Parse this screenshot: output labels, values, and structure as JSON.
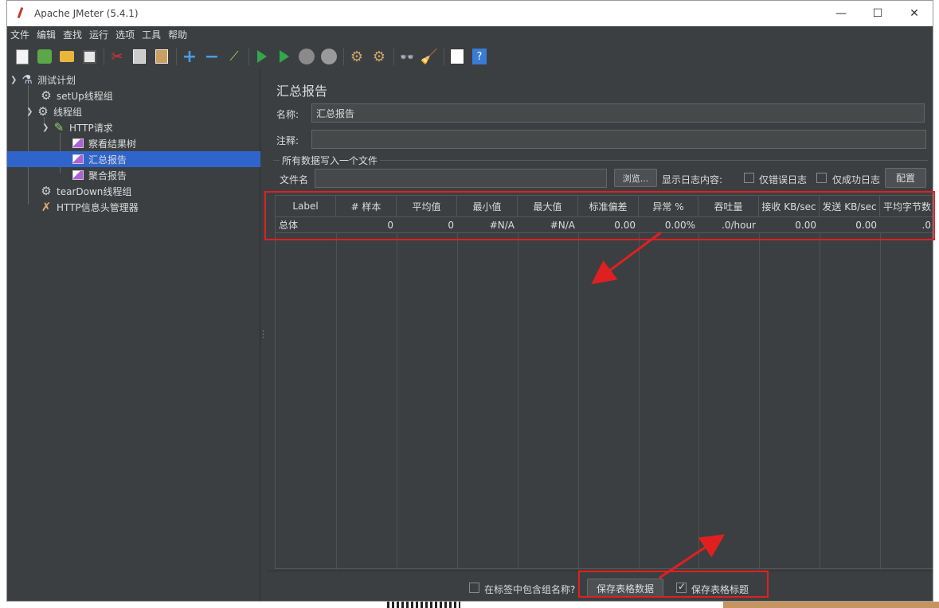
{
  "window": {
    "title": "Apache JMeter (5.4.1)",
    "controls": {
      "minimize": "—",
      "maximize": "☐",
      "close": "✕"
    }
  },
  "menu": [
    "文件",
    "编辑",
    "查找",
    "运行",
    "选项",
    "工具",
    "帮助"
  ],
  "toolbar_icons": [
    "new-icon",
    "templates-icon",
    "open-icon",
    "save-icon",
    "cut-icon",
    "copy-icon",
    "paste-icon",
    "expand-icon",
    "collapse-icon",
    "toggle-icon",
    "start-icon",
    "start-no-pause-icon",
    "stop-icon",
    "shutdown-icon",
    "clear-icon",
    "clear-all-icon",
    "search-icon",
    "reset-search-icon",
    "function-helper-icon",
    "help-icon"
  ],
  "tree": [
    {
      "label": "测试计划",
      "icon": "flask-icon",
      "level": 0,
      "expanded": true
    },
    {
      "label": "setUp线程组",
      "icon": "gear-icon",
      "level": 1
    },
    {
      "label": "线程组",
      "icon": "gear-icon",
      "level": 1,
      "expanded": true
    },
    {
      "label": "HTTP请求",
      "icon": "sampler-icon",
      "level": 2,
      "expanded": true
    },
    {
      "label": "察看结果树",
      "icon": "listener-icon",
      "level": 3
    },
    {
      "label": "汇总报告",
      "icon": "listener-icon",
      "level": 3,
      "selected": true
    },
    {
      "label": "聚合报告",
      "icon": "listener-icon",
      "level": 3
    },
    {
      "label": "tearDown线程组",
      "icon": "gear-icon",
      "level": 1
    },
    {
      "label": "HTTP信息头管理器",
      "icon": "tools-icon",
      "level": 1
    }
  ],
  "panel": {
    "title": "汇总报告",
    "name_label": "名称:",
    "name_value": "汇总报告",
    "comment_label": "注释:",
    "comment_value": "",
    "file_group_title": "所有数据写入一个文件",
    "filename_label": "文件名",
    "filename_value": "",
    "browse_button": "浏览...",
    "log_display_label": "显示日志内容:",
    "errors_only_label": "仅错误日志",
    "success_only_label": "仅成功日志",
    "configure_button": "配置"
  },
  "table": {
    "headers": [
      "Label",
      "# 样本",
      "平均值",
      "最小值",
      "最大值",
      "标准偏差",
      "异常 %",
      "吞吐量",
      "接收 KB/sec",
      "发送 KB/sec",
      "平均字节数"
    ],
    "rows": [
      [
        "总体",
        "0",
        "0",
        "#N/A",
        "#N/A",
        "0.00",
        "0.00%",
        ".0/hour",
        "0.00",
        "0.00",
        ".0"
      ]
    ]
  },
  "bottom": {
    "include_group_label": "在标签中包含组名称?",
    "include_group_checked": false,
    "save_table_button": "保存表格数据",
    "save_header_label": "保存表格标题",
    "save_header_checked": true
  },
  "colors": {
    "background": "#3c3f41",
    "selection": "#2f65ca",
    "highlight": "#e02020"
  }
}
